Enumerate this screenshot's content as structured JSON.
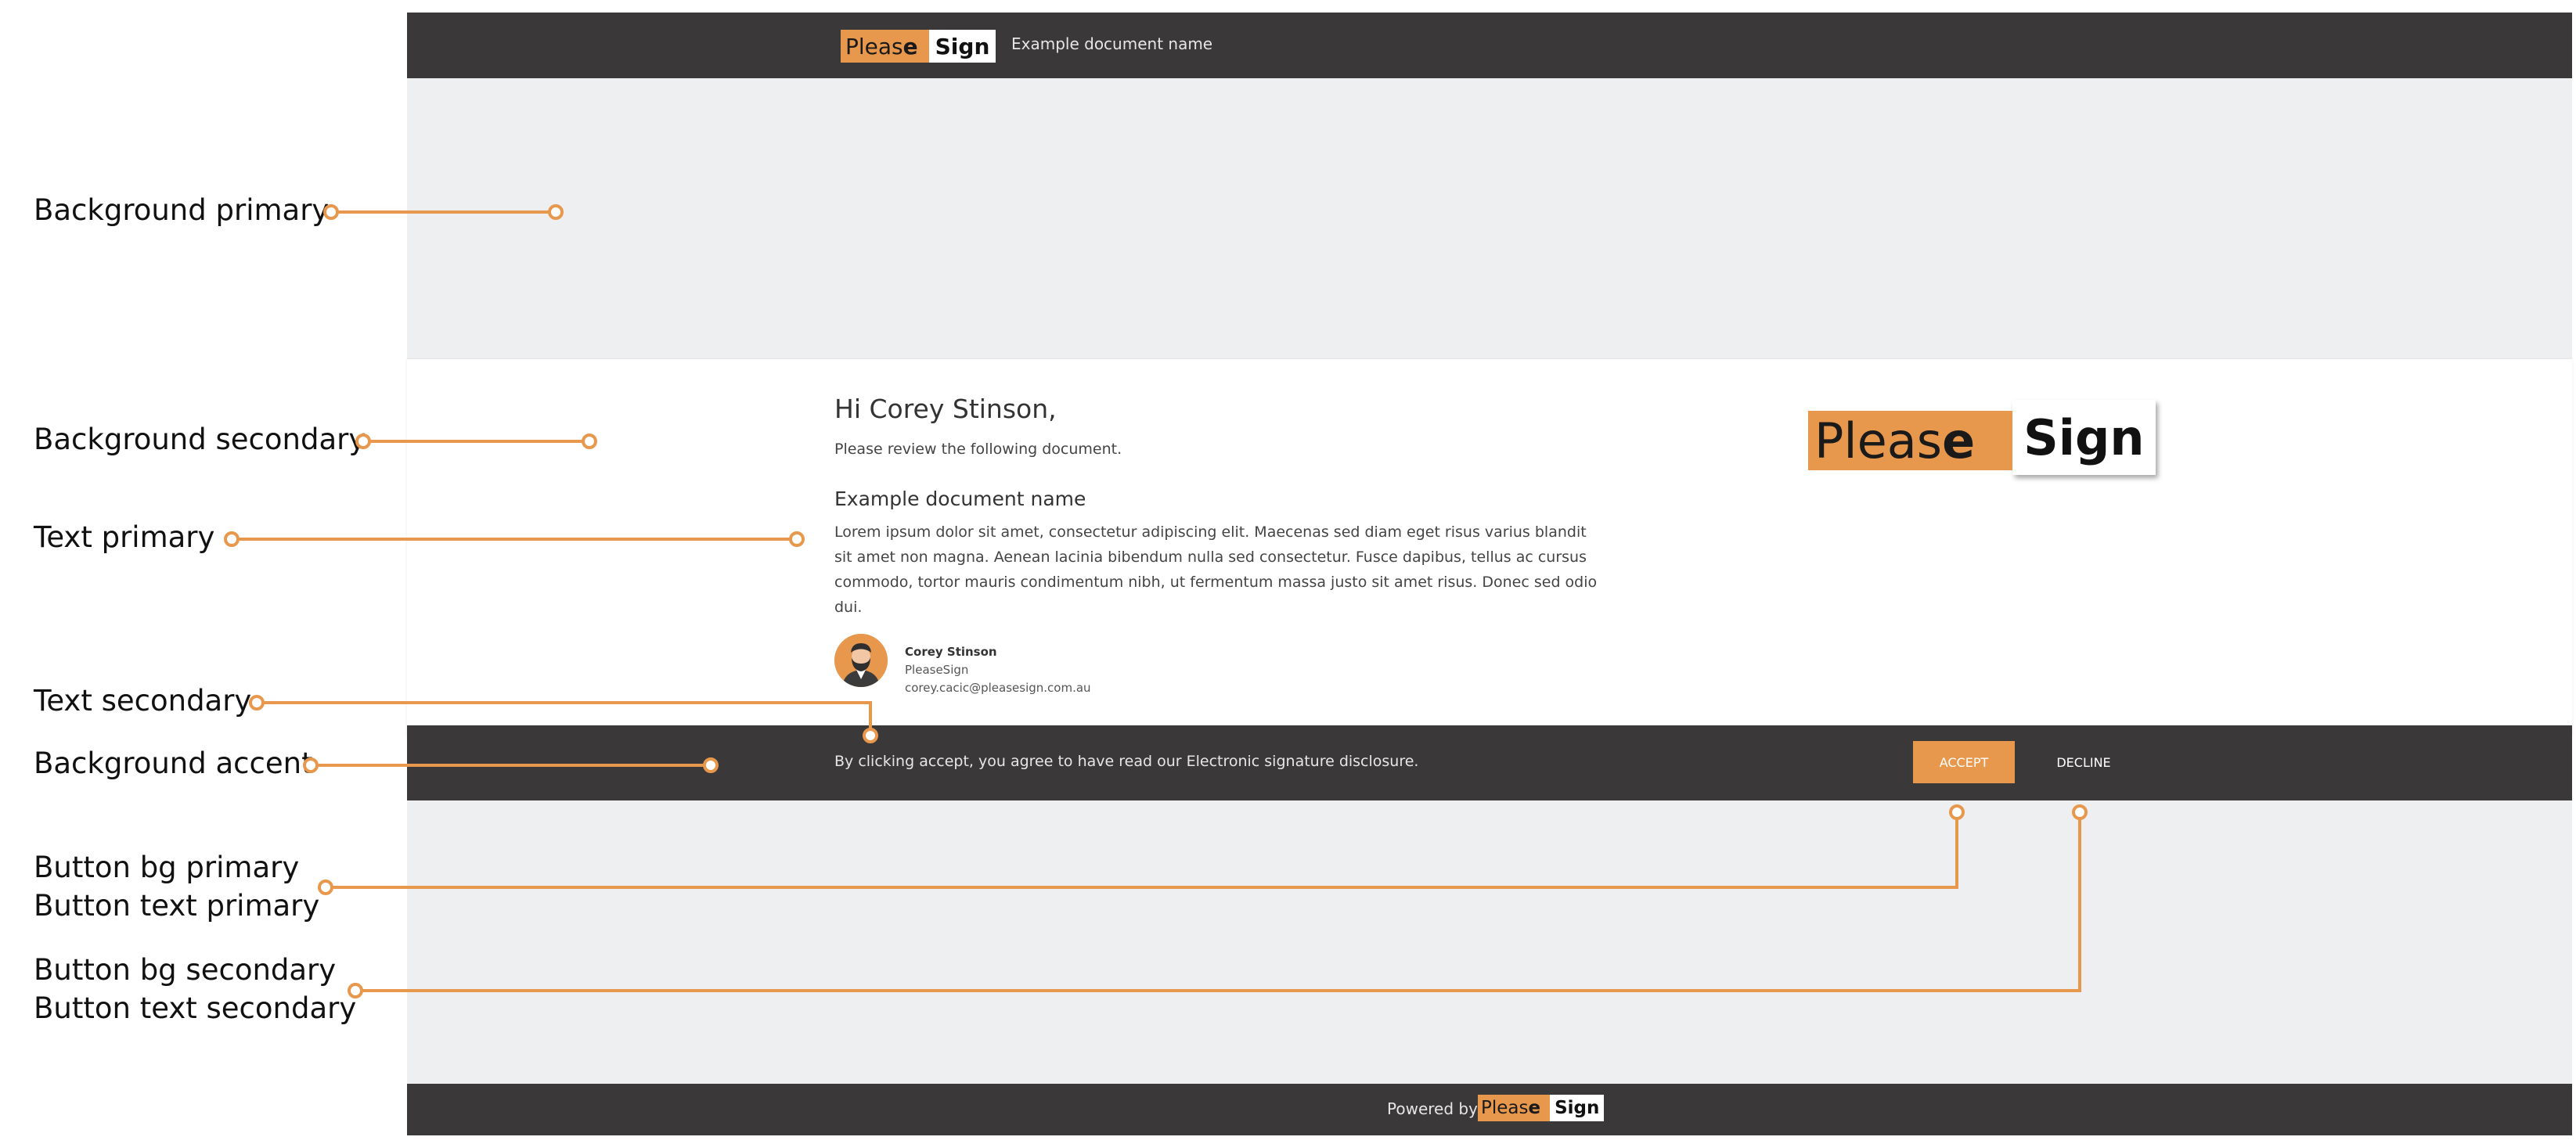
{
  "colors": {
    "accent": "#e8984c",
    "dark_bar": "#3a3838",
    "bg_primary": "#eeeff1",
    "bg_secondary": "#ffffff",
    "annotation_line": "#e8984c"
  },
  "brand": {
    "logo_please": "Pleas",
    "logo_e": "e",
    "logo_sign": "Sign"
  },
  "header": {
    "document_name": "Example document name"
  },
  "card": {
    "greeting": "Hi Corey Stinson,",
    "subline": "Please review the following document.",
    "document_title": "Example document name",
    "body": "Lorem ipsum dolor sit amet, consectetur adipiscing elit. Maecenas sed diam eget risus varius blandit sit amet non magna. Aenean lacinia bibendum nulla sed consectetur. Fusce dapibus, tellus ac cursus commodo, tortor mauris condimentum nibh, ut fermentum massa justo sit amet risus. Donec sed odio dui.",
    "sender": {
      "name": "Corey Stinson",
      "org": "PleaseSign",
      "email": "corey.cacic@pleasesign.com.au",
      "avatar_icon": "bearded-man-avatar-icon"
    }
  },
  "action_bar": {
    "disclosure": "By clicking accept, you agree to have read our Electronic signature disclosure.",
    "accept_label": "ACCEPT",
    "decline_label": "DECLINE"
  },
  "footer": {
    "powered_by": "Powered by"
  },
  "annotations": {
    "background_primary": "Background primary",
    "background_secondary": "Background secondary",
    "text_primary": "Text primary",
    "text_secondary": "Text secondary",
    "background_accent": "Background accent",
    "button_bg_primary": "Button bg primary",
    "button_text_primary": "Button text primary",
    "button_bg_secondary": "Button bg secondary",
    "button_text_secondary": "Button text secondary"
  }
}
